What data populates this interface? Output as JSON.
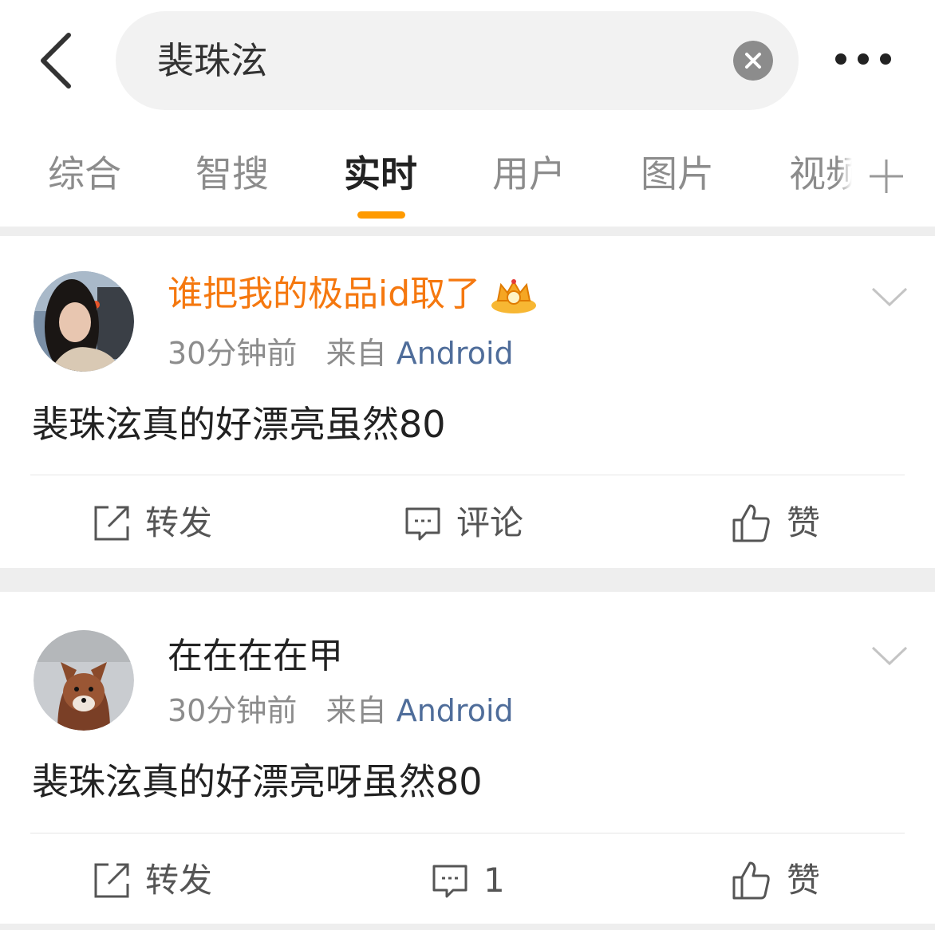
{
  "header": {
    "back_icon": "chevron-left-icon",
    "search_value": "裴珠泫",
    "clear_icon": "close-circle-icon",
    "more_icon": "more-horizontal-icon"
  },
  "tabs": [
    {
      "label": "综合"
    },
    {
      "label": "智搜"
    },
    {
      "label": "实时",
      "active": true
    },
    {
      "label": "用户"
    },
    {
      "label": "图片"
    },
    {
      "label": "视频"
    }
  ],
  "tab_add_icon": "plus-icon",
  "accent_color": "#ff9a00",
  "posts": [
    {
      "username": "谁把我的极品id取了",
      "username_color": "#f5780f",
      "badge_icon": "crown-badge-icon",
      "time": "30分钟前",
      "source_prefix": "来自",
      "source": "Android",
      "text": "裴珠泫真的好漂亮虽然80",
      "actions": {
        "repost": "转发",
        "comment": "评论",
        "like": "赞"
      }
    },
    {
      "username": "在在在在甲",
      "username_color": "#222222",
      "time": "30分钟前",
      "source_prefix": "来自",
      "source": "Android",
      "text": "裴珠泫真的好漂亮呀虽然80",
      "actions": {
        "repost": "转发",
        "comment": "1",
        "like": "赞"
      }
    }
  ]
}
